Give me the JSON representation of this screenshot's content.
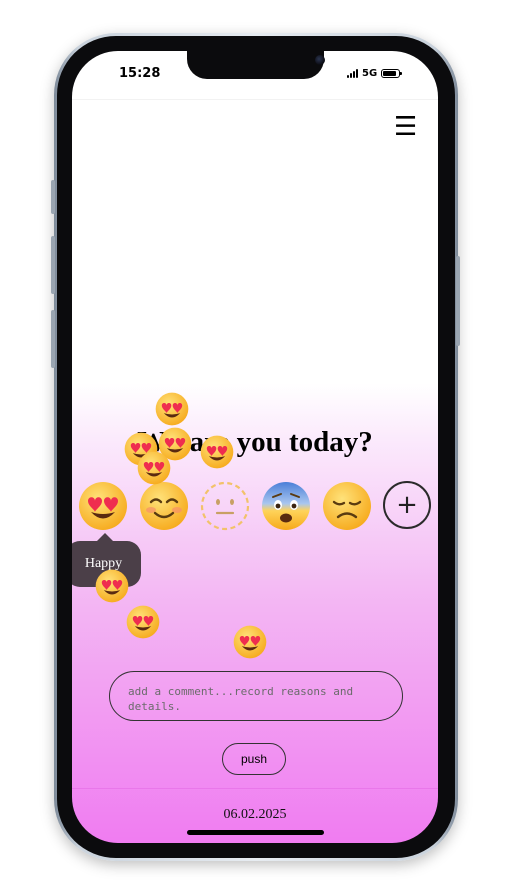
{
  "status_bar": {
    "time": "15:28",
    "network": "5G"
  },
  "header": {
    "menu_icon": "hamburger-icon"
  },
  "main": {
    "question": "Wh   are you today?",
    "moods": [
      {
        "name": "happy",
        "icon": "heart-eyes-emoji",
        "selected": true
      },
      {
        "name": "content",
        "icon": "smiling-blush-emoji"
      },
      {
        "name": "neutral",
        "icon": "dotted-neutral-face-emoji"
      },
      {
        "name": "fearful",
        "icon": "fearful-face-emoji"
      },
      {
        "name": "sad",
        "icon": "disappointed-face-emoji"
      }
    ],
    "tooltip": "Happy",
    "add_label": "+",
    "comment_placeholder": "add a comment...record reasons and details.",
    "push_label": "push"
  },
  "footer": {
    "date": "06.02.2025"
  },
  "colors": {
    "gradient_top": "#ffffff",
    "gradient_bottom": "#f07cf1",
    "emoji_yellow": "#ffc83d",
    "heart_red": "#ef2d4f"
  }
}
